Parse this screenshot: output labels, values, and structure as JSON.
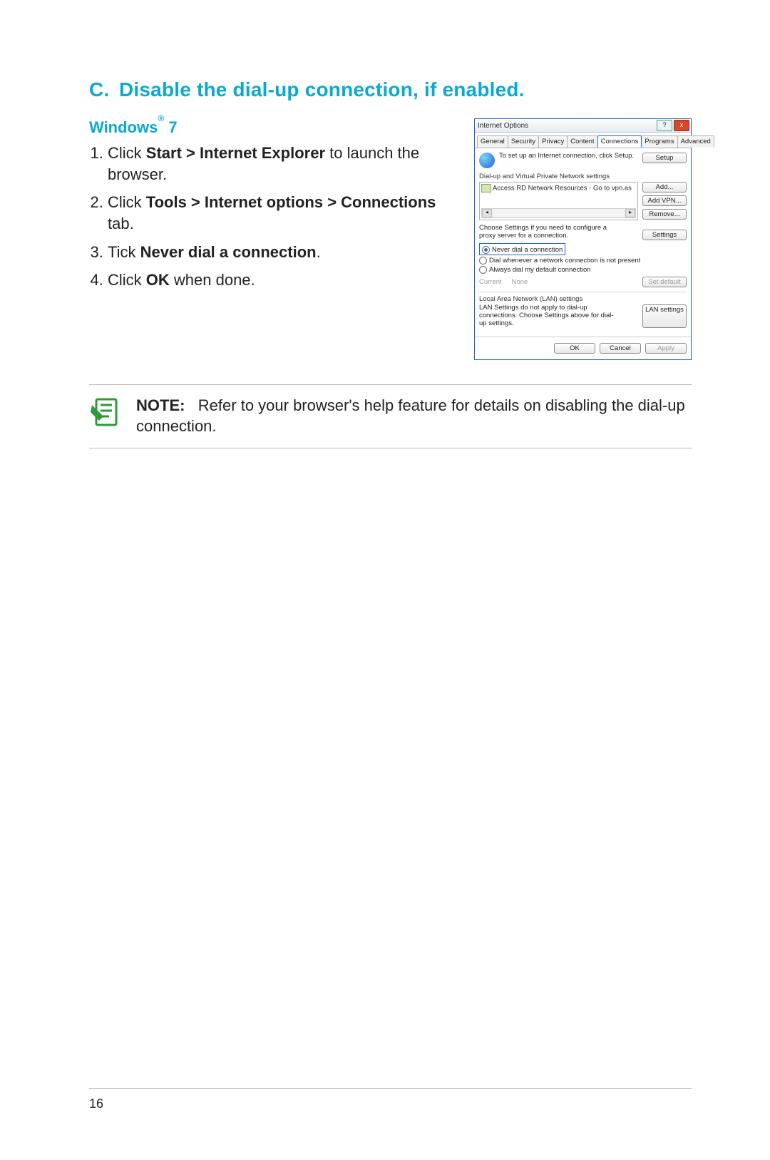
{
  "heading": {
    "letter": "C.",
    "text": "Disable the dial-up connection, if enabled."
  },
  "os": {
    "name": "Windows",
    "reg": "®",
    "ver": "7"
  },
  "steps": [
    {
      "pre": "Click ",
      "b": "Start > Internet Explorer",
      "post": " to launch the browser."
    },
    {
      "pre": "Click ",
      "b": "Tools > Internet options > Connections",
      "post": " tab."
    },
    {
      "pre": "Tick ",
      "b": "Never dial a connection",
      "post": "."
    },
    {
      "pre": "Click ",
      "b": "OK",
      "post": " when done."
    }
  ],
  "dialog": {
    "title": "Internet Options",
    "help": "?",
    "close": "x",
    "tabs": [
      "General",
      "Security",
      "Privacy",
      "Content",
      "Connections",
      "Programs",
      "Advanced"
    ],
    "active_tab": 4,
    "setup_text": "To set up an Internet connection, click Setup.",
    "setup_btn": "Setup",
    "vpn_label": "Dial-up and Virtual Private Network settings",
    "vpn_item": "Access RD Network Resources - Go to vpn.as",
    "add_btn": "Add...",
    "addvpn_btn": "Add VPN...",
    "remove_btn": "Remove...",
    "proxy_text": "Choose Settings if you need to configure a proxy server for a connection.",
    "settings_btn": "Settings",
    "radios": [
      "Never dial a connection",
      "Dial whenever a network connection is not present",
      "Always dial my default connection"
    ],
    "current_label": "Current",
    "current_value": "None",
    "setdefault_btn": "Set default",
    "lan_label": "Local Area Network (LAN) settings",
    "lan_text": "LAN Settings do not apply to dial-up connections. Choose Settings above for dial-up settings.",
    "lan_btn": "LAN settings",
    "ok": "OK",
    "cancel": "Cancel",
    "apply": "Apply"
  },
  "note": {
    "label": "NOTE:",
    "text1": "Refer to your browser's help feature for details on ",
    "text2": "disabling the dial-up connection."
  },
  "page_number": "16"
}
